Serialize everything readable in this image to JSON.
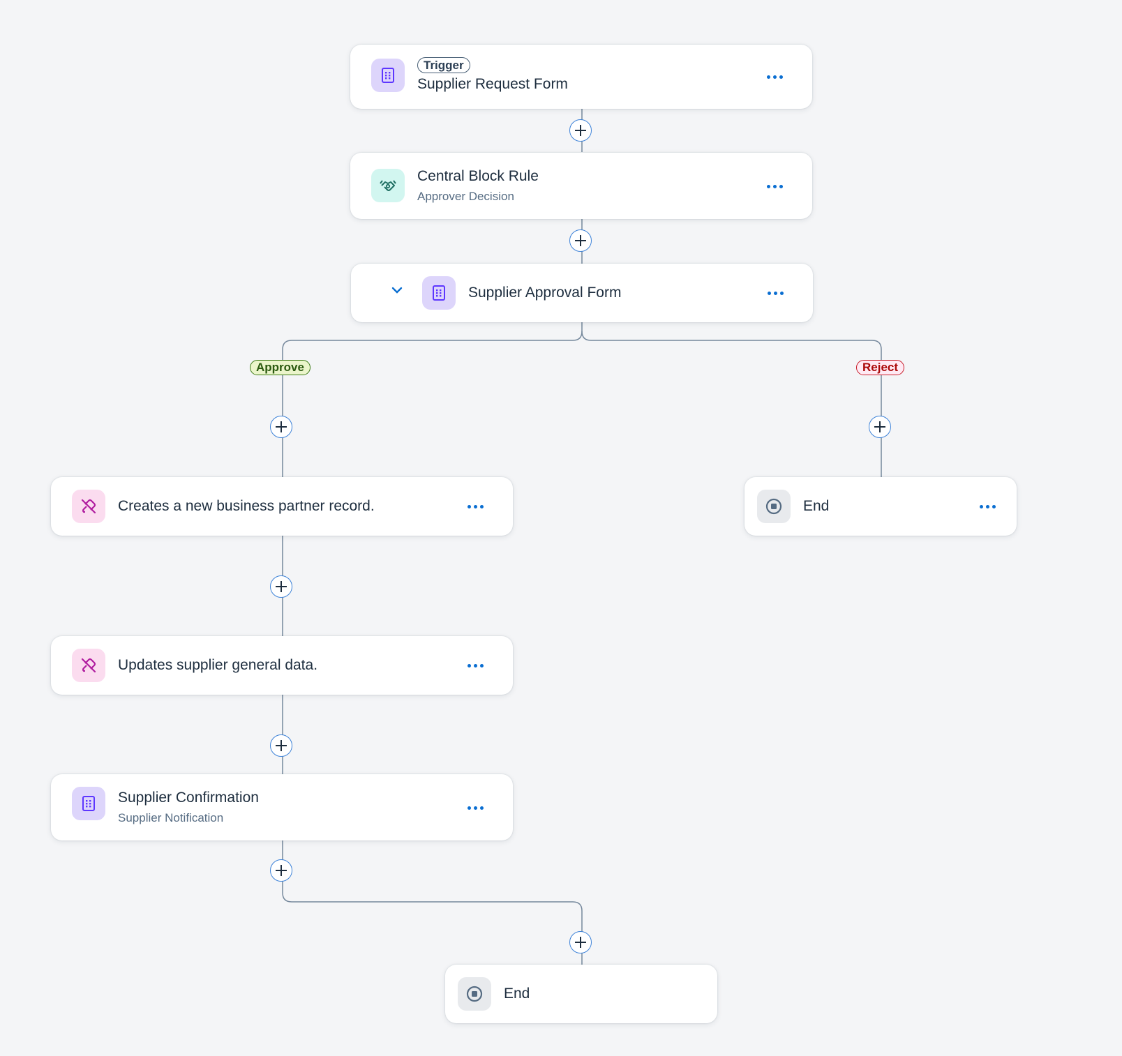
{
  "nodes": {
    "trigger_form": {
      "badge": "Trigger",
      "title": "Supplier Request Form",
      "icon": "form-icon"
    },
    "central_block_rule": {
      "title": "Central Block Rule",
      "subtitle": "Approver Decision",
      "icon": "handshake-icon"
    },
    "supplier_approval_form": {
      "title": "Supplier Approval Form",
      "icon": "form-icon",
      "expand_icon": "chevron-down-icon"
    },
    "create_business_partner": {
      "title": "Creates a new business partner record.",
      "icon": "action-link-icon"
    },
    "update_supplier_data": {
      "title": "Updates supplier general data.",
      "icon": "action-link-icon"
    },
    "supplier_confirmation": {
      "title": "Supplier Confirmation",
      "subtitle": "Supplier Notification",
      "icon": "form-icon"
    },
    "end_reject": {
      "title": "End",
      "icon": "stop-icon"
    },
    "end_final": {
      "title": "End",
      "icon": "stop-icon"
    }
  },
  "branches": {
    "approve": "Approve",
    "reject": "Reject"
  },
  "colors": {
    "background": "#f4f5f7",
    "connector": "#75889c",
    "accent": "#0a6ed1",
    "approve": "#3b7a15",
    "reject": "#c81e2a",
    "form_icon_bg": "#ddd5fb",
    "rule_icon_bg": "#d2f6f0",
    "action_icon_bg": "#fbdcef"
  }
}
